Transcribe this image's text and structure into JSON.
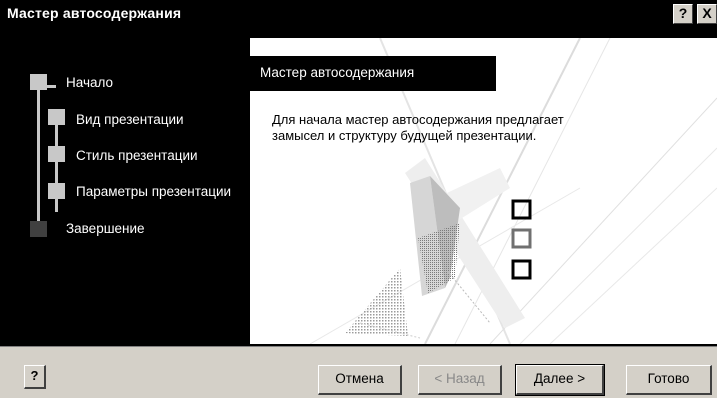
{
  "window": {
    "title": "Мастер автосодержания",
    "help_button": "?",
    "close_button": "X"
  },
  "steps": [
    {
      "label": "Начало",
      "state": "current"
    },
    {
      "label": "Вид презентации",
      "state": "pending"
    },
    {
      "label": "Стиль презентации",
      "state": "pending"
    },
    {
      "label": "Параметры презентации",
      "state": "pending"
    },
    {
      "label": "Завершение",
      "state": "final"
    }
  ],
  "panel": {
    "title": "Мастер автосодержания",
    "description": "Для начала мастер автосодержания предлагает замысел и структуру будущей презентации."
  },
  "buttons": {
    "help": "?",
    "cancel": "Отмена",
    "back": "< Назад",
    "next": "Далее >",
    "finish": "Готово"
  },
  "colors": {
    "titlebar": "#000000",
    "dialog": "#d4d0c8",
    "steps_bg": "#000000",
    "panel_bg": "#ffffff"
  }
}
